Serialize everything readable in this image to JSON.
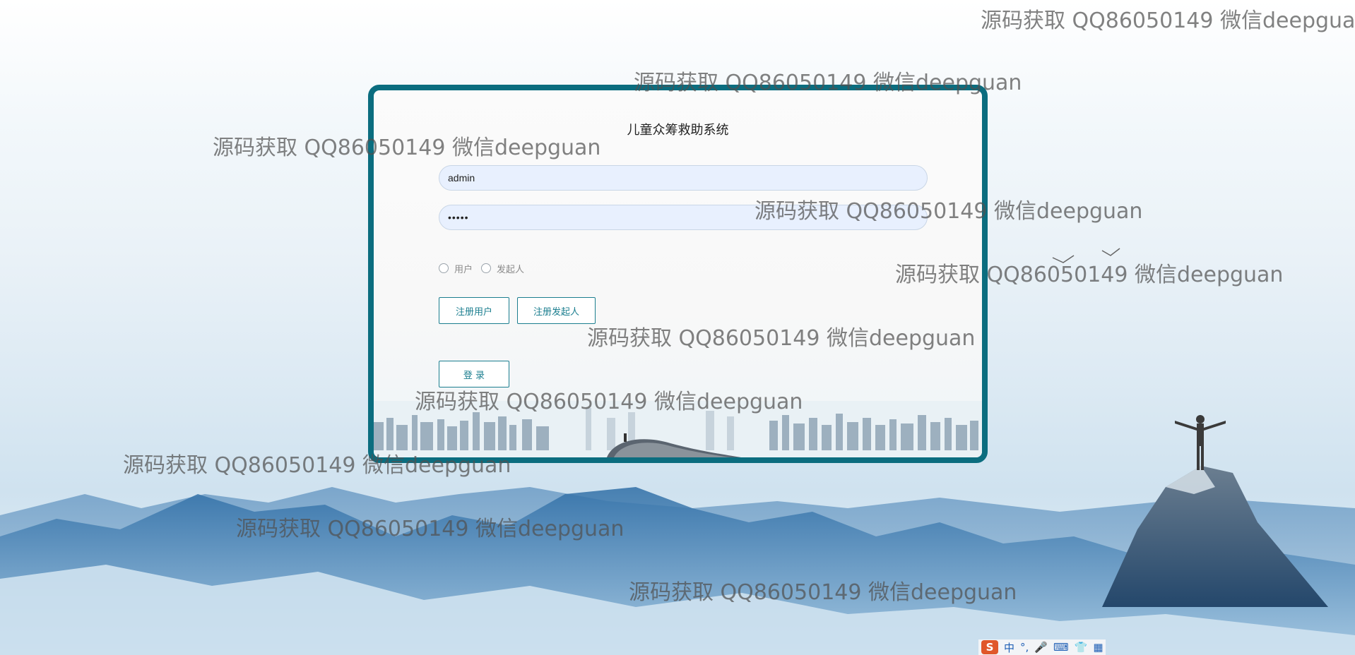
{
  "app": {
    "title": "儿童众筹救助系统"
  },
  "login_form": {
    "username_value": "admin",
    "password_value": "•••••",
    "roles": [
      {
        "label": "用户"
      },
      {
        "label": "发起人"
      }
    ],
    "register_user_label": "注册用户",
    "register_initiator_label": "注册发起人",
    "login_label": "登 录"
  },
  "watermark_text": "源码获取 QQ86050149 微信deepguan",
  "ime_toolbar": {
    "logo": "S",
    "mode": "中",
    "items": [
      "°,",
      "🎤",
      "⌨",
      "👕",
      "▦"
    ]
  },
  "colors": {
    "card_border": "#0b6d7f",
    "button_accent": "#1b7e8f",
    "input_bg": "#e8f0fe",
    "ime_logo": "#e0572a"
  }
}
